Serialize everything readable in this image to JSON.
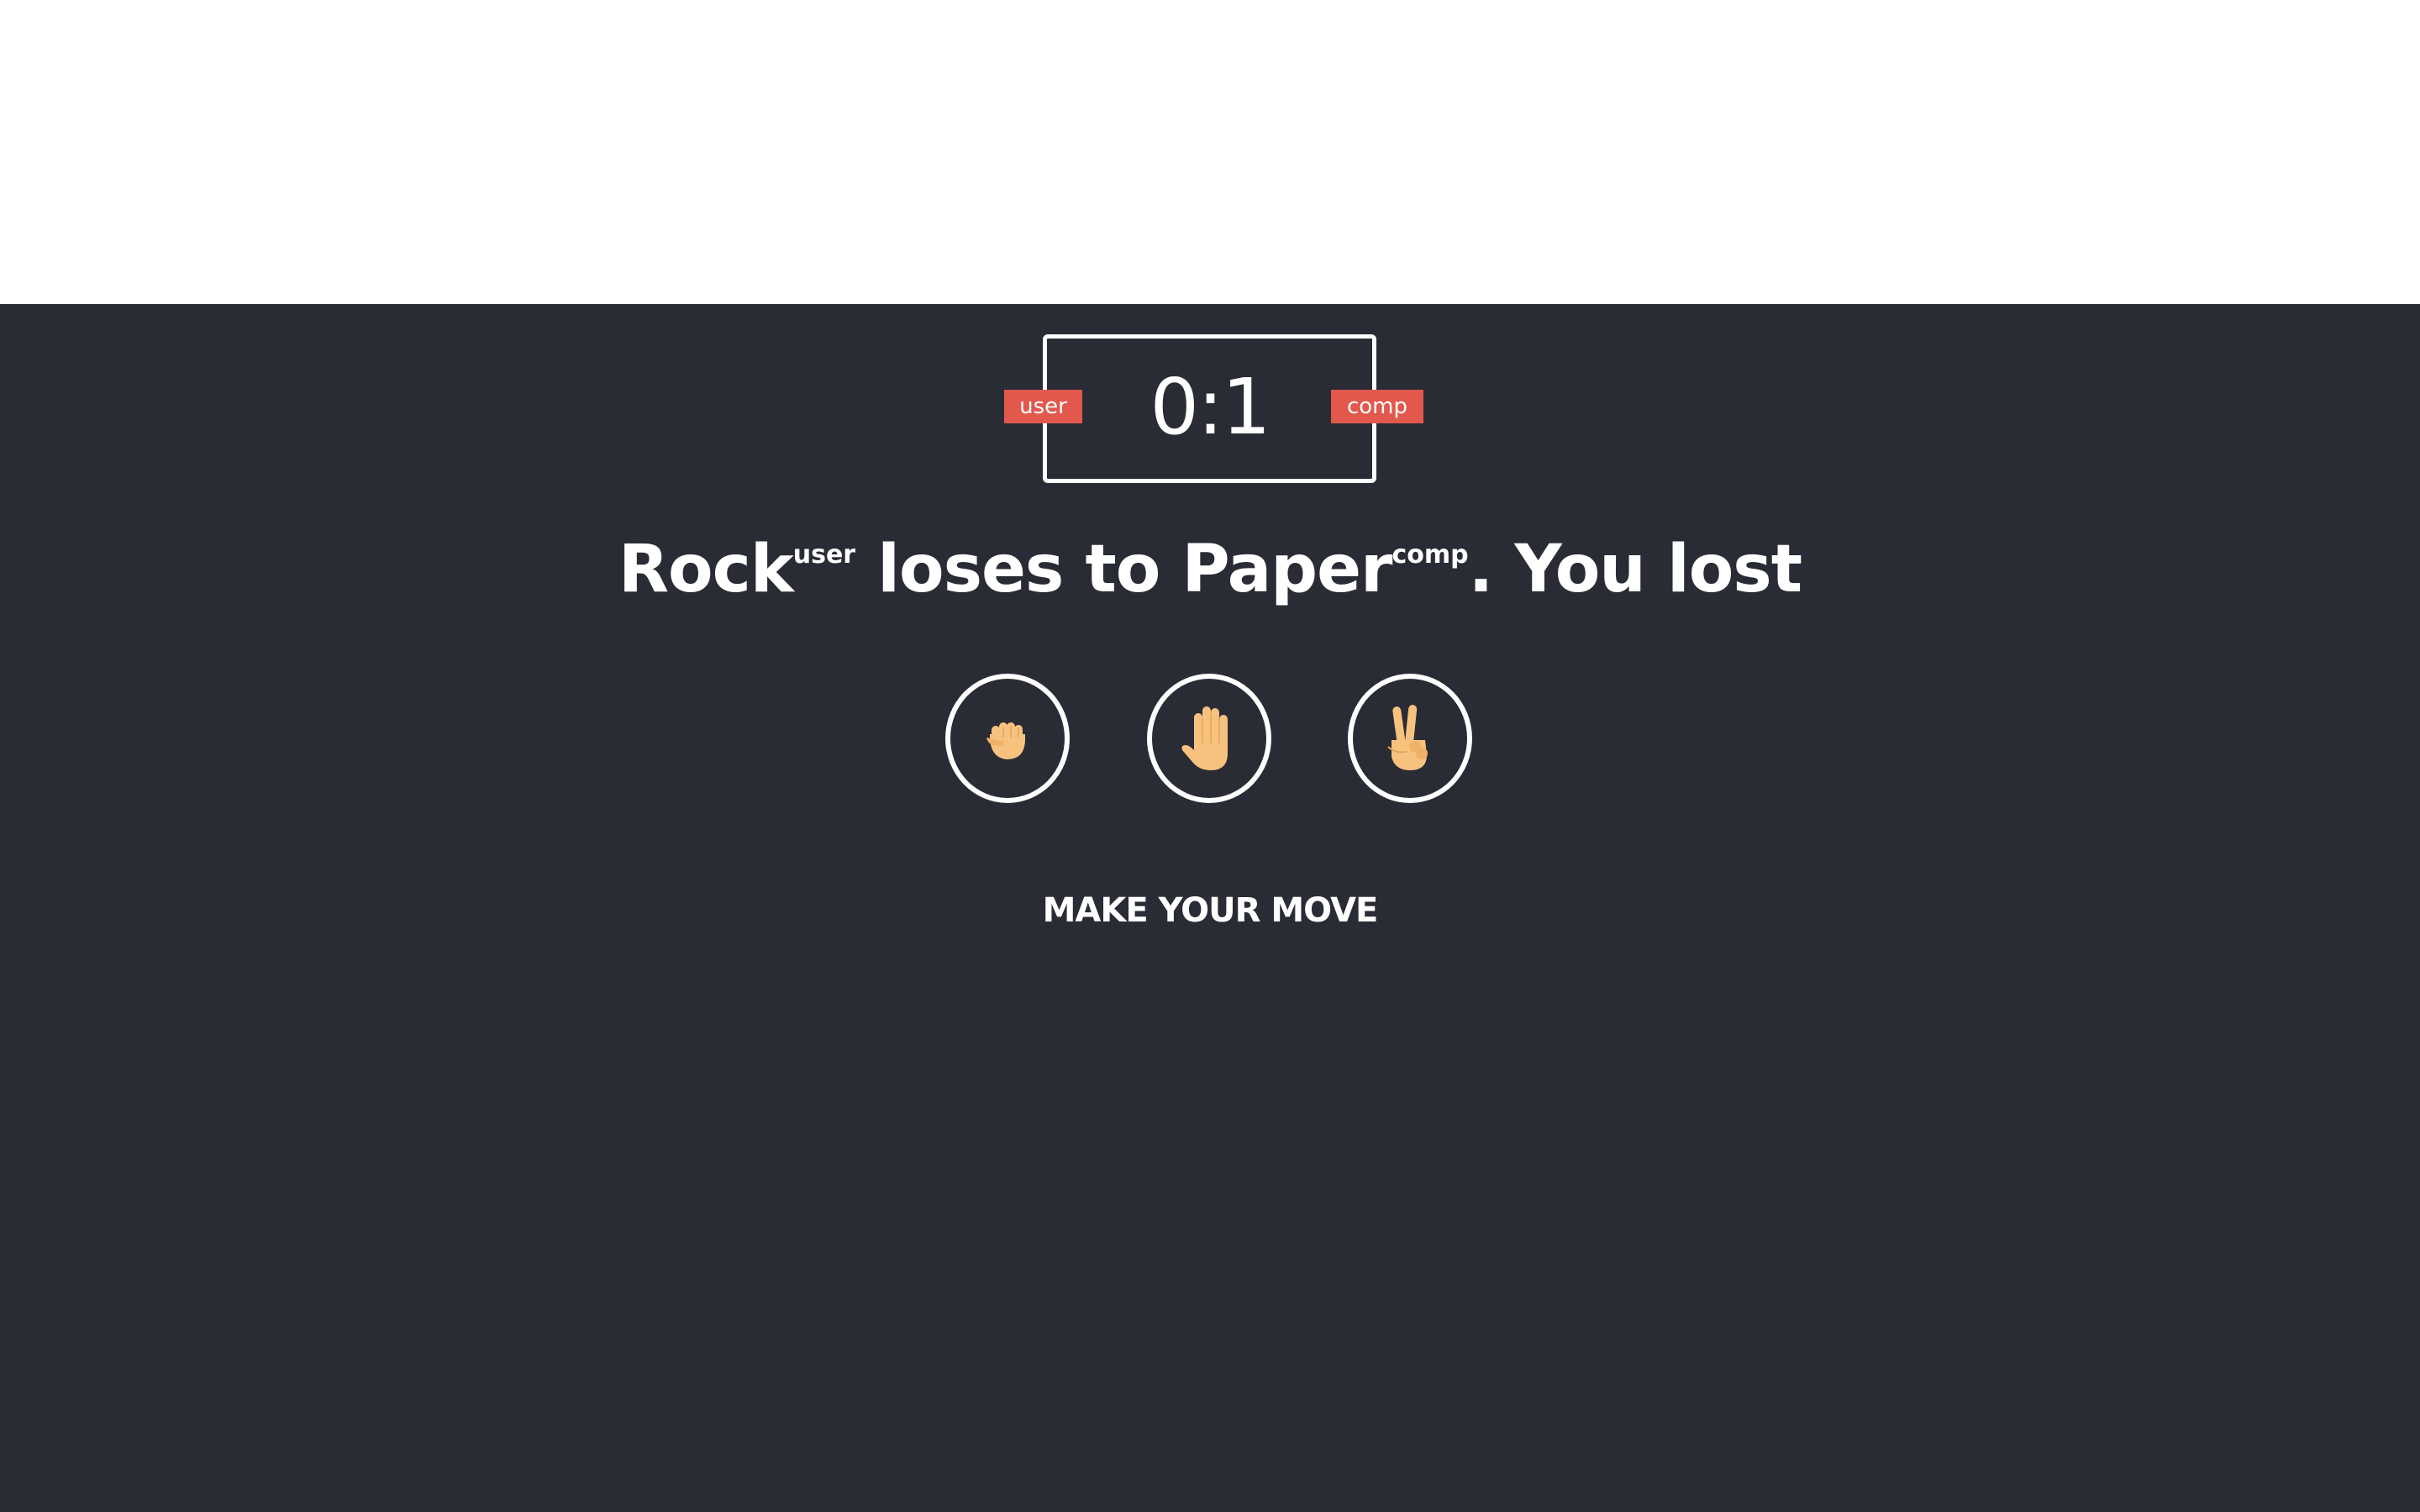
{
  "scoreboard": {
    "score": "0:1",
    "user_label": "user",
    "comp_label": "comp"
  },
  "result": {
    "user_choice": "Rock",
    "user_tag": "user",
    "verb": "loses to",
    "comp_choice": "Paper",
    "comp_tag": "comp",
    "outcome": ". You lost"
  },
  "moves": [
    {
      "name": "rock",
      "icon": "fist-icon"
    },
    {
      "name": "paper",
      "icon": "raised-hand-icon"
    },
    {
      "name": "scissors",
      "icon": "victory-hand-icon"
    }
  ],
  "prompt": "MAKE YOUR MOVE",
  "colors": {
    "background": "#2a2c35",
    "header": "#ffffff",
    "badge": "#e2584d",
    "text": "#ffffff",
    "skin": "#f7c27e"
  }
}
